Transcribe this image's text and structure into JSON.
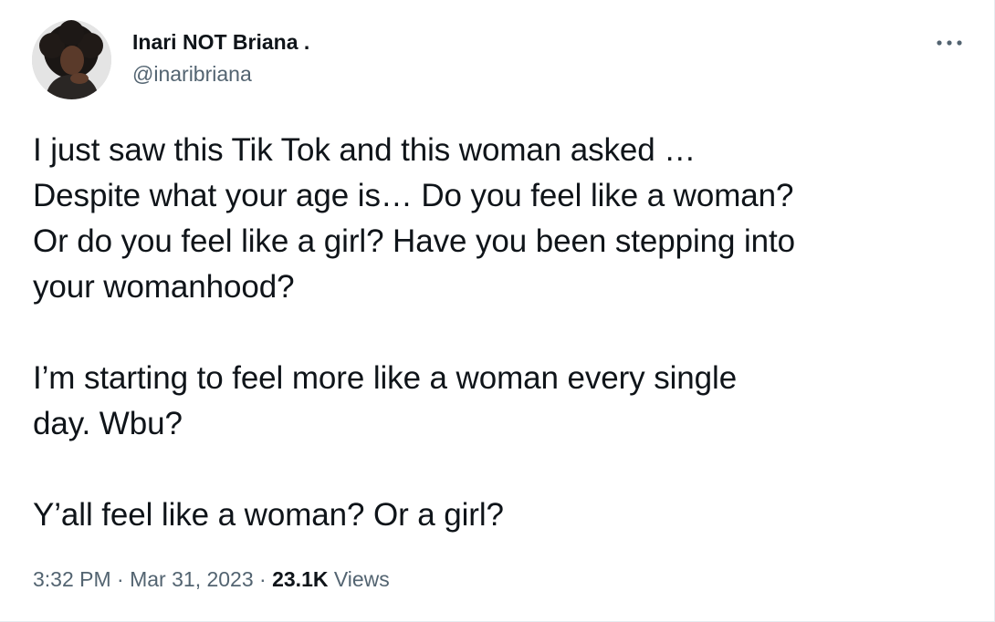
{
  "author": {
    "display_name": "Inari NOT Briana .",
    "handle": "@inaribriana",
    "avatar_icon": "profile-photo"
  },
  "more_icon": "ellipsis-icon",
  "tweet": {
    "lines": [
      "I just saw this Tik Tok and this woman asked …",
      "Despite what your age is… Do you feel like a woman?",
      "Or do you feel like a girl? Have you been stepping into",
      "your womanhood?",
      "I’m starting to feel more like a woman every single",
      "day. Wbu?",
      "Y’all feel like a woman? Or a girl?"
    ]
  },
  "meta": {
    "time": "3:32 PM",
    "separator": "·",
    "date": "Mar 31, 2023",
    "views_count": "23.1K",
    "views_label": "Views"
  },
  "colors": {
    "text": "#0f1419",
    "secondary": "#536471"
  }
}
